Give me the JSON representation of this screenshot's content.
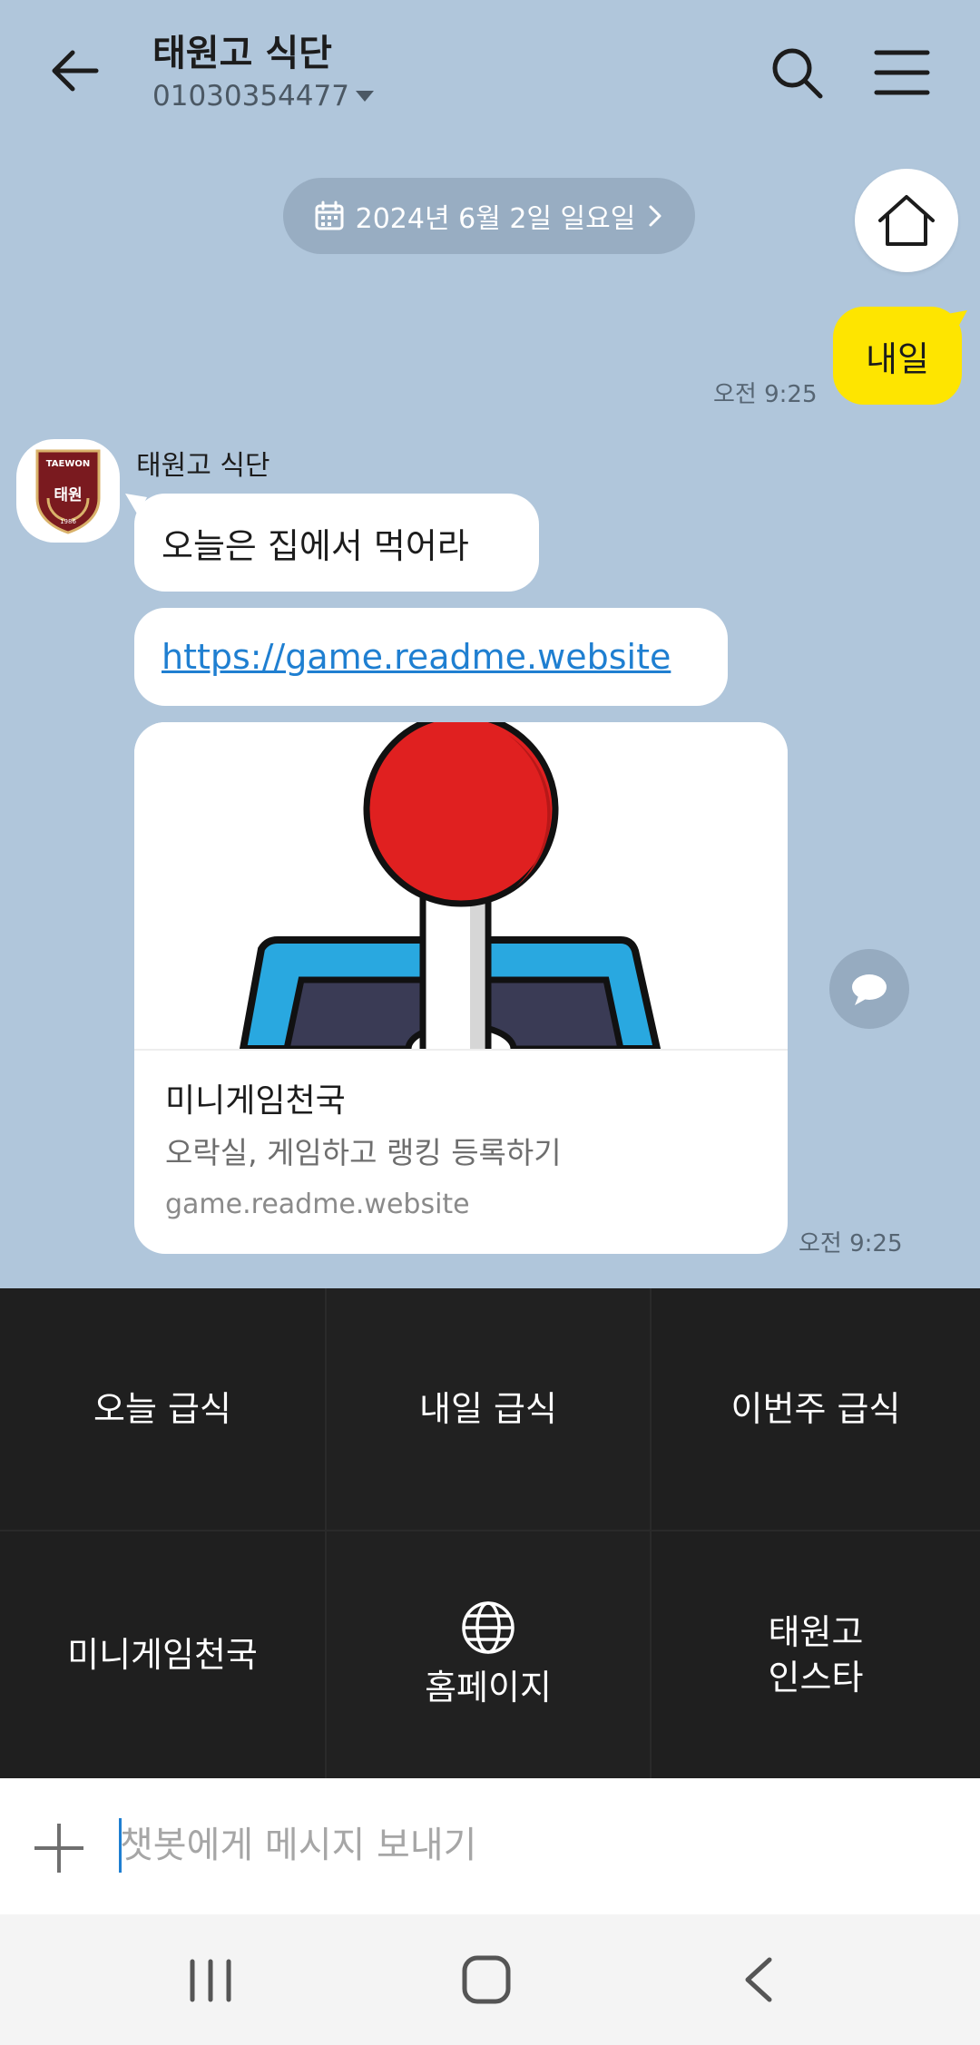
{
  "header": {
    "title": "태원고 식단",
    "subtitle": "01030354477"
  },
  "date_pill": {
    "label": "2024년 6월 2일 일요일"
  },
  "messages": {
    "outgoing": {
      "text": "내일",
      "time": "오전 9:25"
    },
    "incoming": {
      "sender": "태원고 식단",
      "avatar_text_top": "TAEWON",
      "avatar_text_center": "태원",
      "avatar_text_bottom": "1986",
      "text": "오늘은 집에서 먹어라",
      "link": "https://game.readme.website",
      "card": {
        "title": "미니게임천국",
        "description": "오락실, 게임하고 랭킹 등록하기",
        "domain": "game.readme.website"
      },
      "time": "오전 9:25"
    }
  },
  "quick_replies": [
    {
      "label": "오늘 급식"
    },
    {
      "label": "내일 급식"
    },
    {
      "label": "이번주 급식"
    },
    {
      "label": "미니게임천국"
    },
    {
      "label": "홈페이지",
      "icon": "globe-icon"
    },
    {
      "label": "태원고\n인스타"
    }
  ],
  "input": {
    "placeholder": "챗봇에게 메시지 보내기",
    "value": ""
  },
  "colors": {
    "chat_background": "#b0c6db",
    "outgoing_bubble": "#fee500",
    "link": "#1f7fd1",
    "quick_reply_background": "#1f1f1f",
    "avatar_crest": "#7a1a1f"
  },
  "icons": {
    "back": "arrow-left-icon",
    "search": "search-icon",
    "menu": "hamburger-menu-icon",
    "calendar": "calendar-icon",
    "chevron": "chevron-right-icon",
    "home": "home-icon",
    "share": "speech-bubble-icon",
    "plus": "plus-icon"
  }
}
